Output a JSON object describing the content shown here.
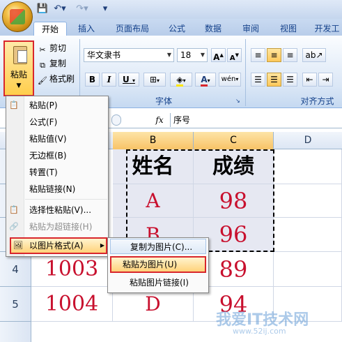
{
  "ribbon": {
    "tabs": [
      "开始",
      "插入",
      "页面布局",
      "公式",
      "数据",
      "审阅",
      "视图",
      "开发工"
    ],
    "active_tab": "开始",
    "clipboard": {
      "paste": "粘贴",
      "cut": "剪切",
      "copy": "复制",
      "format_painter": "格式刷"
    },
    "font": {
      "name": "华文隶书",
      "size": "18",
      "bold": "B",
      "italic": "I",
      "underline": "U",
      "grow": "A",
      "shrink": "A",
      "color_letter": "A",
      "phonetic": "wén"
    },
    "groups": {
      "font": "字体",
      "alignment": "对齐方式"
    }
  },
  "formula_bar": {
    "fx": "fx",
    "value": "序号"
  },
  "columns": [
    "B",
    "C",
    "D"
  ],
  "rows": [
    {
      "num": "",
      "a": "",
      "b": "姓名",
      "c": "成绩"
    },
    {
      "num": "",
      "a": "",
      "b": "A",
      "c": "98"
    },
    {
      "num": "",
      "a": "",
      "b": "B",
      "c": "96"
    },
    {
      "num": "4",
      "a": "1003",
      "b": "C",
      "c": "89"
    },
    {
      "num": "5",
      "a": "1004",
      "b": "D",
      "c": "94"
    }
  ],
  "paste_menu": {
    "items": [
      {
        "label": "粘贴(P)",
        "disabled": false
      },
      {
        "label": "公式(F)",
        "disabled": false
      },
      {
        "label": "粘贴值(V)",
        "disabled": false
      },
      {
        "label": "无边框(B)",
        "disabled": false
      },
      {
        "label": "转置(T)",
        "disabled": false
      },
      {
        "label": "粘贴链接(N)",
        "disabled": false
      },
      {
        "label": "选择性粘贴(V)...",
        "disabled": false
      },
      {
        "label": "粘贴为超链接(H)",
        "disabled": true
      },
      {
        "label": "以图片格式(A)",
        "disabled": false
      }
    ]
  },
  "picture_submenu": {
    "items": [
      "复制为图片(C)...",
      "粘贴为图片(U)",
      "粘贴图片链接(I)"
    ]
  },
  "watermark": {
    "text": "我爱IT技术网",
    "url": "www.52ij.com"
  },
  "colors": {
    "accent_red": "#d8262c",
    "data_red": "#c8102e",
    "ribbon_blue": "#15428b"
  }
}
